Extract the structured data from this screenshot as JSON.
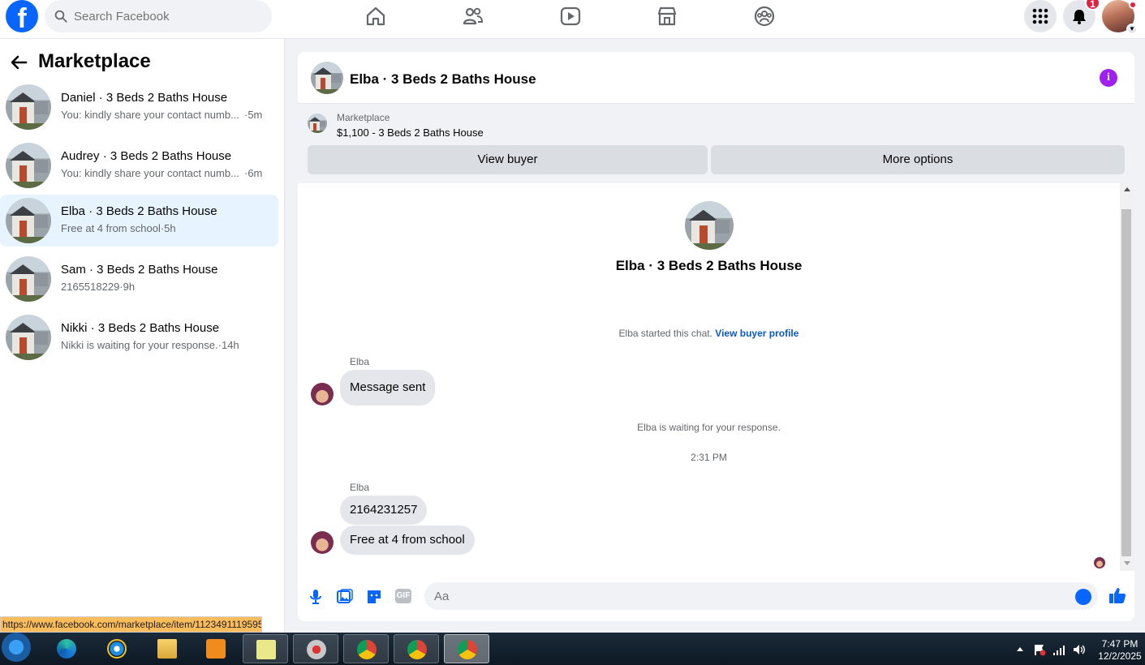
{
  "topnav": {
    "logo": "f",
    "search_placeholder": "Search Facebook",
    "notification_count": "1"
  },
  "sidebar": {
    "title": "Marketplace",
    "conversations": [
      {
        "name": "Daniel · 3 Beds 2 Baths House",
        "preview": "You: kindly share your contact numb...",
        "time": "·5m"
      },
      {
        "name": "Audrey · 3 Beds 2 Baths House",
        "preview": "You: kindly share your contact numb...",
        "time": "·6m"
      },
      {
        "name": "Elba · 3 Beds 2 Baths House",
        "preview": "Free at 4 from school·5h",
        "time": ""
      },
      {
        "name": "Sam · 3 Beds 2 Baths House",
        "preview": "2165518229·9h",
        "time": ""
      },
      {
        "name": "Nikki · 3 Beds 2 Baths House",
        "preview": "Nikki is waiting for your response.·14h",
        "time": ""
      }
    ]
  },
  "status_url": "https://www.facebook.com/marketplace/item/1123491119595",
  "chat": {
    "header_title": "Elba · 3 Beds 2 Baths House",
    "info_icon": "i",
    "marketplace_label": "Marketplace",
    "listing": "$1,100 - 3 Beds 2 Baths House",
    "view_buyer_btn": "View buyer",
    "more_options_btn": "More options",
    "hero_title": "Elba · 3 Beds 2 Baths House",
    "started_text": "Elba started this chat.",
    "view_profile_link": "View buyer profile",
    "msg1_sender": "Elba",
    "msg1_text": "Message sent",
    "waiting_text": "Elba is waiting for your response.",
    "timestamp": "2:31 PM",
    "msg2_sender": "Elba",
    "msg2_text": "2164231257",
    "msg3_text": "Free at 4 from school",
    "composer_placeholder": "Aa",
    "gif_label": "GIF"
  },
  "taskbar": {
    "time": "7:47 PM",
    "date": "12/2/2025"
  },
  "colors": {
    "brand": "#0866ff",
    "active_conversation": "#e7f3ff",
    "info_icon": "#a020f0",
    "badge": "#e41e3f"
  }
}
